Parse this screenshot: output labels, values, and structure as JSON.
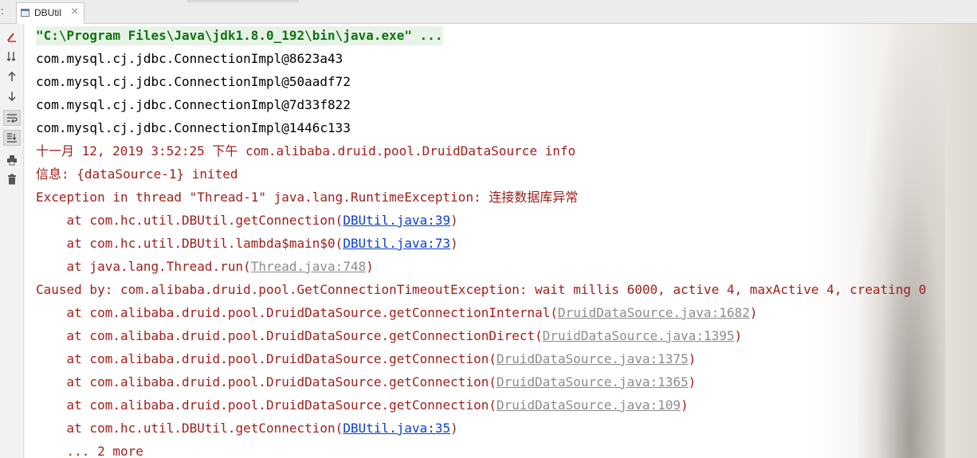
{
  "tabbar": {
    "left_marker": ":",
    "tab_label": "DBUtil",
    "close_glyph": "×"
  },
  "toolbar": {
    "tools": [
      {
        "name": "rerun-icon"
      },
      {
        "name": "sort-down-icon"
      },
      {
        "name": "up-arrow-icon"
      },
      {
        "name": "down-arrow-icon"
      },
      {
        "name": "soft-wrap-icon"
      },
      {
        "name": "scroll-to-end-icon"
      },
      {
        "name": "print-icon"
      },
      {
        "name": "trash-icon"
      }
    ]
  },
  "colors": {
    "error": "#a0201c",
    "command": "#0d7310",
    "link": "#0b3fd1",
    "link_library": "#8c8c8c"
  },
  "console": {
    "command": "\"C:\\Program Files\\Java\\jdk1.8.0_192\\bin\\java.exe\" ...",
    "conn_lines": [
      "com.mysql.cj.jdbc.ConnectionImpl@8623a43",
      "com.mysql.cj.jdbc.ConnectionImpl@50aadf72",
      "com.mysql.cj.jdbc.ConnectionImpl@7d33f822",
      "com.mysql.cj.jdbc.ConnectionImpl@1446c133"
    ],
    "log_date": "十一月 12, 2019 3:52:25 下午 com.alibaba.druid.pool.DruidDataSource info",
    "log_info": "信息: {dataSource-1} inited",
    "exception": "Exception in thread \"Thread-1\" java.lang.RuntimeException: 连接数据库异常",
    "frames1": [
      {
        "prefix": "    at com.hc.util.DBUtil.getConnection(",
        "link": "DBUtil.java:39",
        "suffix": ")"
      },
      {
        "prefix": "    at com.hc.util.DBUtil.lambda$main$0(",
        "link": "DBUtil.java:73",
        "suffix": ")"
      },
      {
        "prefix": "    at java.lang.Thread.run(",
        "link": "Thread.java:748",
        "suffix": ")"
      }
    ],
    "caused_by": "Caused by: com.alibaba.druid.pool.GetConnectionTimeoutException: wait millis 6000, active 4, maxActive 4, creating 0",
    "frames2": [
      {
        "prefix": "    at com.alibaba.druid.pool.DruidDataSource.getConnectionInternal(",
        "link": "DruidDataSource.java:1682",
        "suffix": ")"
      },
      {
        "prefix": "    at com.alibaba.druid.pool.DruidDataSource.getConnectionDirect(",
        "link": "DruidDataSource.java:1395",
        "suffix": ")"
      },
      {
        "prefix": "    at com.alibaba.druid.pool.DruidDataSource.getConnection(",
        "link": "DruidDataSource.java:1375",
        "suffix": ")"
      },
      {
        "prefix": "    at com.alibaba.druid.pool.DruidDataSource.getConnection(",
        "link": "DruidDataSource.java:1365",
        "suffix": ")"
      },
      {
        "prefix": "    at com.alibaba.druid.pool.DruidDataSource.getConnection(",
        "link": "DruidDataSource.java:109",
        "suffix": ")"
      },
      {
        "prefix": "    at com.hc.util.DBUtil.getConnection(",
        "link": "DBUtil.java:35",
        "suffix": ")"
      }
    ],
    "more": "    ... 2 more"
  }
}
